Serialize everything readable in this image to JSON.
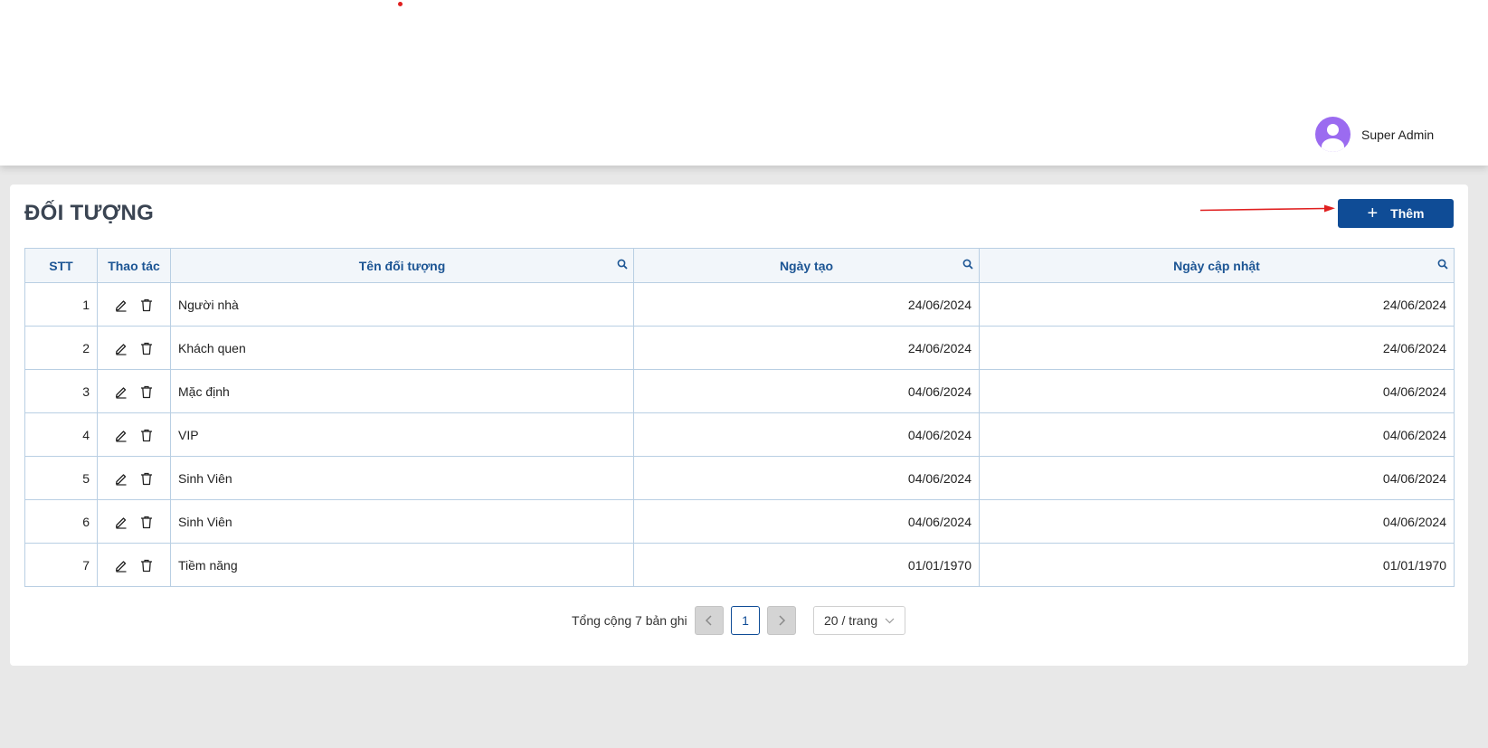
{
  "header": {
    "user_name": "Super Admin"
  },
  "page": {
    "title": "ĐỐI TƯỢNG",
    "add_label": "Thêm"
  },
  "table": {
    "columns": [
      "STT",
      "Thao tác",
      "Tên đối tượng",
      "Ngày tạo",
      "Ngày cập nhật"
    ],
    "rows": [
      [
        "1",
        "Người nhà",
        "24/06/2024",
        "24/06/2024"
      ],
      [
        "2",
        "Khách quen",
        "24/06/2024",
        "24/06/2024"
      ],
      [
        "3",
        "Mặc định",
        "04/06/2024",
        "04/06/2024"
      ],
      [
        "4",
        "VIP",
        "04/06/2024",
        "04/06/2024"
      ],
      [
        "5",
        "Sinh Viên",
        "04/06/2024",
        "04/06/2024"
      ],
      [
        "6",
        "Sinh Viên",
        "04/06/2024",
        "04/06/2024"
      ],
      [
        "7",
        "Tiềm năng",
        "01/01/1970",
        "01/01/1970"
      ]
    ]
  },
  "pagination": {
    "total_text": "Tổng cộng 7 bản ghi",
    "current_page": "1",
    "page_size": "20 / trang"
  },
  "icons": {
    "search": "search-icon",
    "edit": "pencil-icon",
    "delete": "trash-icon",
    "add": "plus-icon",
    "prev": "chevron-left-icon",
    "next": "chevron-right-icon",
    "dropdown": "chevron-down-icon",
    "avatar": "user-icon",
    "annotation": "red-arrow"
  },
  "colors": {
    "primary": "#0f4c96",
    "header_text": "#1c5594",
    "avatar": "#9b6bf0",
    "annotation": "#e02020"
  }
}
